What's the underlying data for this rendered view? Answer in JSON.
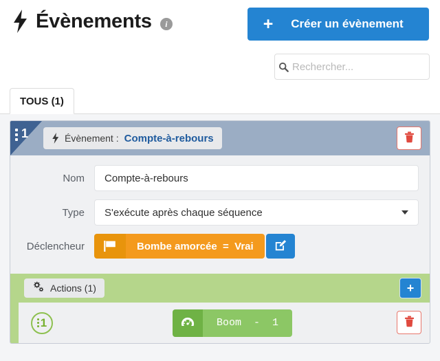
{
  "header": {
    "bolt_icon": "bolt-icon",
    "title": "Évènements",
    "info_icon": "info-icon",
    "create_button": {
      "plus": "+",
      "label": "Créer un évènement"
    },
    "search": {
      "icon": "search-icon",
      "placeholder": "Rechercher...",
      "value": ""
    }
  },
  "tabs": [
    {
      "label": "TOUS (1)",
      "active": true
    }
  ],
  "event": {
    "number": "1",
    "drag_handle": "drag-dots-icon",
    "pill": {
      "icon": "bolt-icon",
      "label": "Évènement :",
      "value": "Compte-à-rebours"
    },
    "delete_icon": "trash-icon",
    "fields": [
      {
        "label": "Nom",
        "type": "text",
        "value": "Compte-à-rebours"
      },
      {
        "label": "Type",
        "type": "select",
        "value": "S'exécute après chaque séquence",
        "caret": "chevron-down-icon"
      }
    ],
    "trigger": {
      "label": "Déclencheur",
      "icon": "flag-icon",
      "text": "Bombe amorcée  =  Vrai",
      "edit_icon": "edit-icon"
    },
    "actions_section": {
      "icon": "cogs-icon",
      "label": "Actions (1)",
      "add_button": "+",
      "rows": [
        {
          "number": "1",
          "drag_handle": "drag-dots-icon",
          "icon": "gauge-icon",
          "text": "Boom  -  1",
          "delete_icon": "trash-icon"
        }
      ]
    }
  },
  "colors": {
    "accent_blue": "#2484d2",
    "header_blue_gray": "#9badc4",
    "corner_blue": "#3f6292",
    "actions_green": "#b5d68b",
    "action_pill_green": "#8cc765",
    "trigger_orange": "#f49a1d",
    "danger_red": "#e8766b"
  }
}
